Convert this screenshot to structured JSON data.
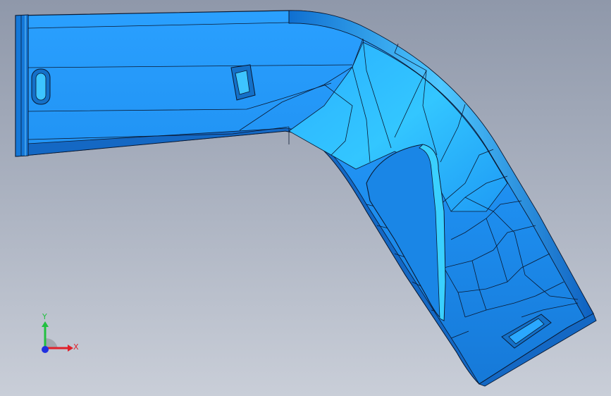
{
  "viewport": {
    "background_top": "#8f98aa",
    "background_bottom": "#c9ced8"
  },
  "model": {
    "body_color": "#1e8ff0",
    "highlight_color": "#2fc0ff",
    "edge_color": "#0a1a33",
    "pocket_color": "#1a86e6"
  },
  "triad": {
    "x_label": "X",
    "y_label": "Y",
    "x_color": "#e0202a",
    "y_color": "#22c040",
    "z_color": "#2030e0"
  }
}
